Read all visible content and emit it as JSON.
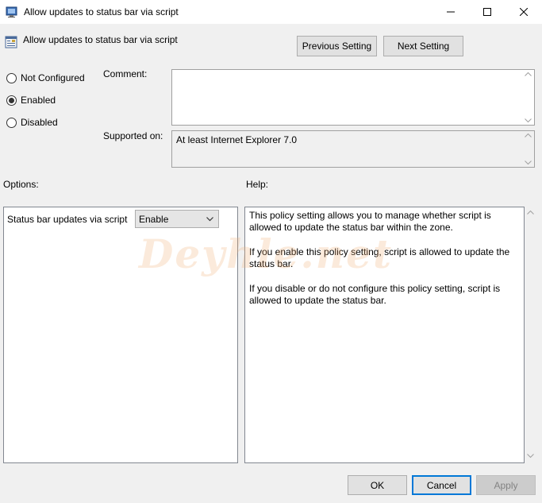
{
  "window": {
    "title": "Allow updates to status bar via script"
  },
  "header": {
    "policy_title": "Allow updates to status bar via script",
    "prev_label": "Previous Setting",
    "next_label": "Next Setting"
  },
  "state": {
    "options": [
      "Not Configured",
      "Enabled",
      "Disabled"
    ],
    "selected": "Enabled"
  },
  "comment": {
    "label": "Comment:",
    "value": ""
  },
  "supported": {
    "label": "Supported on:",
    "value": "At least Internet Explorer 7.0"
  },
  "options_section": {
    "label": "Options:",
    "setting_label": "Status bar updates via script",
    "setting_value": "Enable"
  },
  "help_section": {
    "label": "Help:",
    "paragraphs": [
      "This policy setting allows you to manage whether script is allowed to update the status bar within the zone.",
      "If you enable this policy setting, script is allowed to update the status bar.",
      "If you disable or do not configure this policy setting, script is allowed to update the status bar."
    ]
  },
  "footer": {
    "ok_label": "OK",
    "cancel_label": "Cancel",
    "apply_label": "Apply"
  },
  "watermark": "Deyhle.net",
  "colors": {
    "background": "#f0f0f0",
    "accent_focus": "#0078d7",
    "disabled_text": "#838383"
  },
  "icons": [
    "app-icon",
    "policy-icon",
    "minimize-icon",
    "maximize-icon",
    "close-icon",
    "scroll-up-icon",
    "scroll-down-icon",
    "chevron-down-icon"
  ]
}
